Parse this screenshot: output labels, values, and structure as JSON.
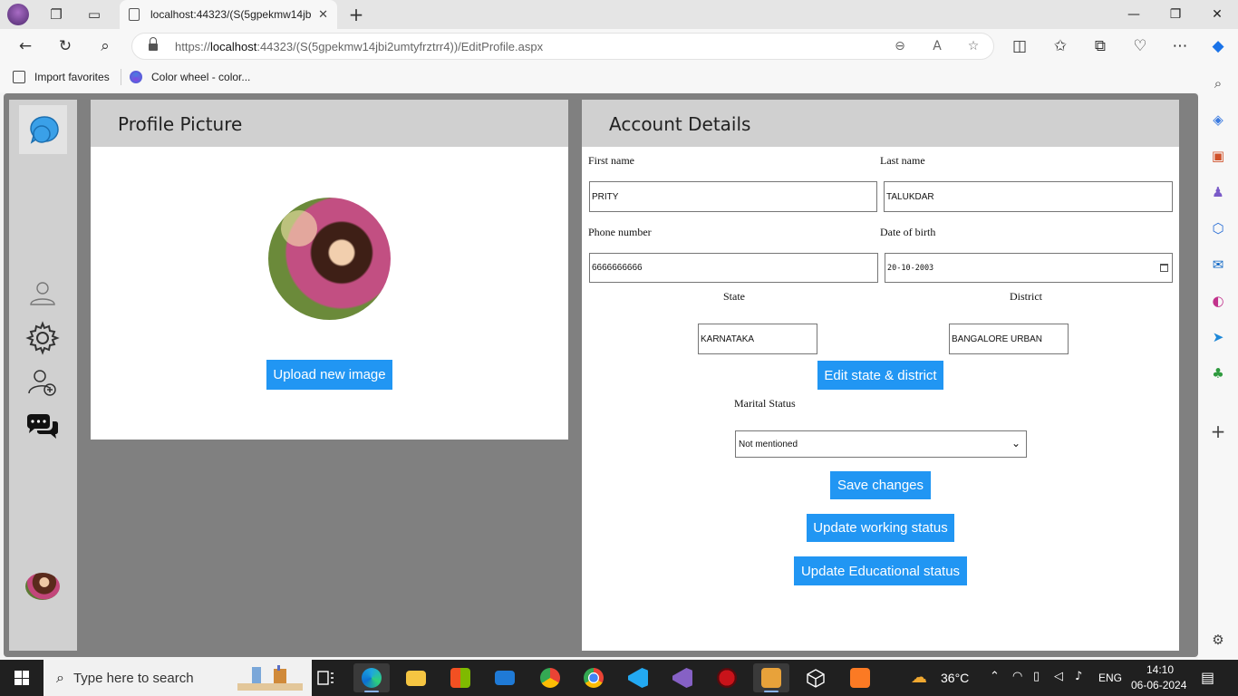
{
  "browser": {
    "tab_title": "localhost:44323/(S(5gpekmw14jb",
    "url_prefix": "https://",
    "url_host": "localhost",
    "url_rest": ":44323/(S(5gpekmw14jbi2umtyfrztrr4))/EditProfile.aspx",
    "favorites": [
      {
        "label": "Import favorites"
      },
      {
        "label": "Color wheel - color..."
      }
    ]
  },
  "profile_card": {
    "title": "Profile Picture",
    "upload_label": "Upload new image"
  },
  "account_card": {
    "title": "Account Details",
    "first_name_label": "First name",
    "first_name_value": "PRITY",
    "last_name_label": "Last name",
    "last_name_value": "TALUKDAR",
    "phone_label": "Phone number",
    "phone_value": "6666666666",
    "dob_label": "Date of birth",
    "dob_value": "20-10-2003",
    "state_label": "State",
    "state_value": "KARNATAKA",
    "district_label": "District",
    "district_value": "BANGALORE URBAN",
    "edit_state_label": "Edit state & district",
    "marital_label": "Marital Status",
    "marital_value": "Not mentioned",
    "save_label": "Save changes",
    "working_label": "Update working status",
    "education_label": "Update Educational status"
  },
  "taskbar": {
    "search_placeholder": "Type here to search",
    "weather": "36°C",
    "language": "ENG",
    "time": "14:10",
    "date": "06-06-2024"
  },
  "colors": {
    "primary_button": "#2196f3",
    "sidebar": "#d0d0d0",
    "page_bg": "#808080"
  }
}
